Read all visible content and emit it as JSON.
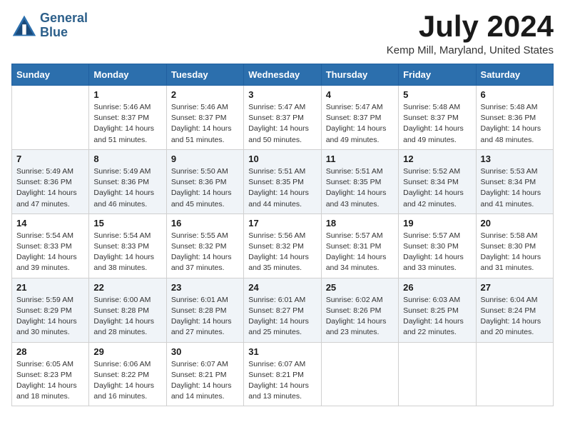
{
  "logo": {
    "line1": "General",
    "line2": "Blue"
  },
  "title": "July 2024",
  "subtitle": "Kemp Mill, Maryland, United States",
  "weekdays": [
    "Sunday",
    "Monday",
    "Tuesday",
    "Wednesday",
    "Thursday",
    "Friday",
    "Saturday"
  ],
  "weeks": [
    [
      {
        "day": "",
        "info": ""
      },
      {
        "day": "1",
        "info": "Sunrise: 5:46 AM\nSunset: 8:37 PM\nDaylight: 14 hours\nand 51 minutes."
      },
      {
        "day": "2",
        "info": "Sunrise: 5:46 AM\nSunset: 8:37 PM\nDaylight: 14 hours\nand 51 minutes."
      },
      {
        "day": "3",
        "info": "Sunrise: 5:47 AM\nSunset: 8:37 PM\nDaylight: 14 hours\nand 50 minutes."
      },
      {
        "day": "4",
        "info": "Sunrise: 5:47 AM\nSunset: 8:37 PM\nDaylight: 14 hours\nand 49 minutes."
      },
      {
        "day": "5",
        "info": "Sunrise: 5:48 AM\nSunset: 8:37 PM\nDaylight: 14 hours\nand 49 minutes."
      },
      {
        "day": "6",
        "info": "Sunrise: 5:48 AM\nSunset: 8:36 PM\nDaylight: 14 hours\nand 48 minutes."
      }
    ],
    [
      {
        "day": "7",
        "info": "Sunrise: 5:49 AM\nSunset: 8:36 PM\nDaylight: 14 hours\nand 47 minutes."
      },
      {
        "day": "8",
        "info": "Sunrise: 5:49 AM\nSunset: 8:36 PM\nDaylight: 14 hours\nand 46 minutes."
      },
      {
        "day": "9",
        "info": "Sunrise: 5:50 AM\nSunset: 8:36 PM\nDaylight: 14 hours\nand 45 minutes."
      },
      {
        "day": "10",
        "info": "Sunrise: 5:51 AM\nSunset: 8:35 PM\nDaylight: 14 hours\nand 44 minutes."
      },
      {
        "day": "11",
        "info": "Sunrise: 5:51 AM\nSunset: 8:35 PM\nDaylight: 14 hours\nand 43 minutes."
      },
      {
        "day": "12",
        "info": "Sunrise: 5:52 AM\nSunset: 8:34 PM\nDaylight: 14 hours\nand 42 minutes."
      },
      {
        "day": "13",
        "info": "Sunrise: 5:53 AM\nSunset: 8:34 PM\nDaylight: 14 hours\nand 41 minutes."
      }
    ],
    [
      {
        "day": "14",
        "info": "Sunrise: 5:54 AM\nSunset: 8:33 PM\nDaylight: 14 hours\nand 39 minutes."
      },
      {
        "day": "15",
        "info": "Sunrise: 5:54 AM\nSunset: 8:33 PM\nDaylight: 14 hours\nand 38 minutes."
      },
      {
        "day": "16",
        "info": "Sunrise: 5:55 AM\nSunset: 8:32 PM\nDaylight: 14 hours\nand 37 minutes."
      },
      {
        "day": "17",
        "info": "Sunrise: 5:56 AM\nSunset: 8:32 PM\nDaylight: 14 hours\nand 35 minutes."
      },
      {
        "day": "18",
        "info": "Sunrise: 5:57 AM\nSunset: 8:31 PM\nDaylight: 14 hours\nand 34 minutes."
      },
      {
        "day": "19",
        "info": "Sunrise: 5:57 AM\nSunset: 8:30 PM\nDaylight: 14 hours\nand 33 minutes."
      },
      {
        "day": "20",
        "info": "Sunrise: 5:58 AM\nSunset: 8:30 PM\nDaylight: 14 hours\nand 31 minutes."
      }
    ],
    [
      {
        "day": "21",
        "info": "Sunrise: 5:59 AM\nSunset: 8:29 PM\nDaylight: 14 hours\nand 30 minutes."
      },
      {
        "day": "22",
        "info": "Sunrise: 6:00 AM\nSunset: 8:28 PM\nDaylight: 14 hours\nand 28 minutes."
      },
      {
        "day": "23",
        "info": "Sunrise: 6:01 AM\nSunset: 8:28 PM\nDaylight: 14 hours\nand 27 minutes."
      },
      {
        "day": "24",
        "info": "Sunrise: 6:01 AM\nSunset: 8:27 PM\nDaylight: 14 hours\nand 25 minutes."
      },
      {
        "day": "25",
        "info": "Sunrise: 6:02 AM\nSunset: 8:26 PM\nDaylight: 14 hours\nand 23 minutes."
      },
      {
        "day": "26",
        "info": "Sunrise: 6:03 AM\nSunset: 8:25 PM\nDaylight: 14 hours\nand 22 minutes."
      },
      {
        "day": "27",
        "info": "Sunrise: 6:04 AM\nSunset: 8:24 PM\nDaylight: 14 hours\nand 20 minutes."
      }
    ],
    [
      {
        "day": "28",
        "info": "Sunrise: 6:05 AM\nSunset: 8:23 PM\nDaylight: 14 hours\nand 18 minutes."
      },
      {
        "day": "29",
        "info": "Sunrise: 6:06 AM\nSunset: 8:22 PM\nDaylight: 14 hours\nand 16 minutes."
      },
      {
        "day": "30",
        "info": "Sunrise: 6:07 AM\nSunset: 8:21 PM\nDaylight: 14 hours\nand 14 minutes."
      },
      {
        "day": "31",
        "info": "Sunrise: 6:07 AM\nSunset: 8:21 PM\nDaylight: 14 hours\nand 13 minutes."
      },
      {
        "day": "",
        "info": ""
      },
      {
        "day": "",
        "info": ""
      },
      {
        "day": "",
        "info": ""
      }
    ]
  ]
}
